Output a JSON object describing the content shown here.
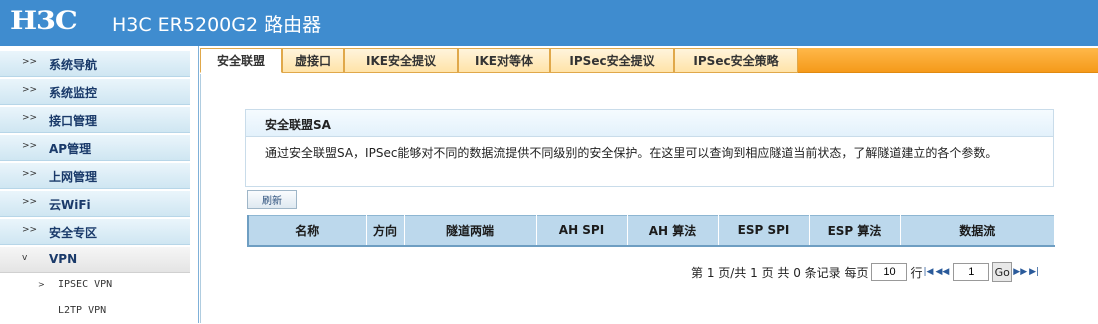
{
  "header": {
    "logo": "H3C",
    "title": "H3C ER5200G2 路由器"
  },
  "sidebar": {
    "items": [
      {
        "label": "系统导航"
      },
      {
        "label": "系统监控"
      },
      {
        "label": "接口管理"
      },
      {
        "label": "AP管理"
      },
      {
        "label": "上网管理"
      },
      {
        "label": "云WiFi"
      },
      {
        "label": "安全专区"
      },
      {
        "label": "VPN"
      }
    ],
    "subitems": [
      {
        "label": "IPSEC VPN"
      },
      {
        "label": "L2TP VPN"
      }
    ]
  },
  "tabs": [
    {
      "label": "安全联盟"
    },
    {
      "label": "虚接口"
    },
    {
      "label": "IKE安全提议"
    },
    {
      "label": "IKE对等体"
    },
    {
      "label": "IPSec安全提议"
    },
    {
      "label": "IPSec安全策略"
    }
  ],
  "panel": {
    "title": "安全联盟SA",
    "description": "通过安全联盟SA，IPSec能够对不同的数据流提供不同级别的安全保护。在这里可以查询到相应隧道当前状态，了解隧道建立的各个参数。"
  },
  "refresh_label": "刷新",
  "table": {
    "columns": [
      "名称",
      "方向",
      "隧道两端",
      "AH SPI",
      "AH 算法",
      "ESP SPI",
      "ESP 算法",
      "数据流"
    ]
  },
  "pager": {
    "summary": "第 1 页/共 1 页 共 0 条记录 每页",
    "per_page": "10",
    "rows_label": "行",
    "page": "1",
    "go_label": "Go"
  }
}
